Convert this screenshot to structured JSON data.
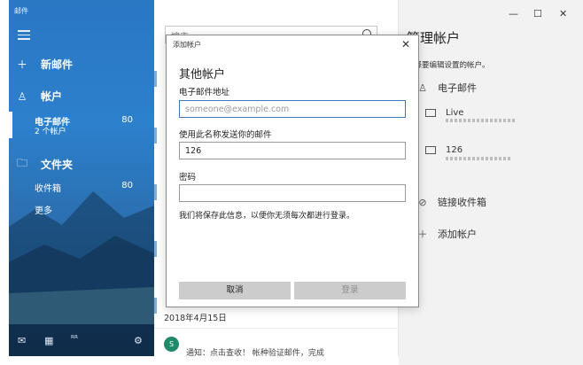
{
  "app_title": "邮件",
  "sidebar": {
    "new_mail": "新邮件",
    "accounts_header": "帐户",
    "account": {
      "name": "电子邮件",
      "sub": "2 个帐户",
      "count": "80"
    },
    "folders_header": "文件夹",
    "folders": [
      {
        "name": "收件箱",
        "count": "80"
      },
      {
        "name": "更多",
        "count": ""
      }
    ]
  },
  "middle": {
    "search_placeholder": "搜索",
    "date_header": "2018年4月15日",
    "avatar_letter": "S",
    "snippet": "通知：点击查收！  帐种验证邮件，完成"
  },
  "right": {
    "title": "管理帐户",
    "hint": "选择要编辑设置的帐户。",
    "email_header": "电子邮件",
    "accounts": [
      {
        "name": "Live"
      },
      {
        "name": "126"
      }
    ],
    "link_inboxes": "链接收件箱",
    "add_account": "添加帐户"
  },
  "dialog": {
    "title": "添加帐户",
    "heading": "其他帐户",
    "email_label": "电子邮件地址",
    "email_placeholder": "someone@example.com",
    "email_value": "",
    "name_label": "使用此名称发送你的邮件",
    "name_value": "126",
    "password_label": "密码",
    "password_value": "",
    "note": "我们将保存此信息，以便你无须每次都进行登录。",
    "cancel": "取消",
    "login": "登录"
  },
  "colors": {
    "sidebar_blue": "#2c80cc",
    "accent": "#3b7bc4",
    "button_gray": "#cccccc"
  }
}
